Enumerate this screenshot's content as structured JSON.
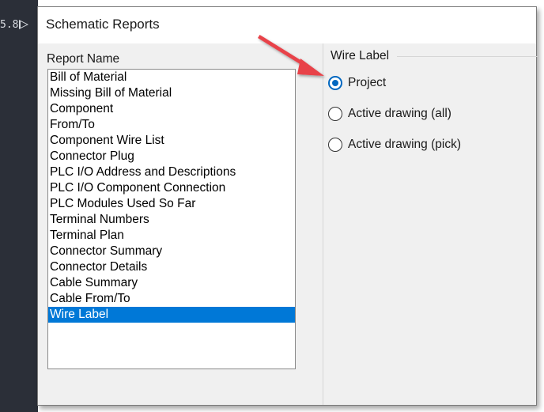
{
  "background": {
    "snippet_text": "5.8"
  },
  "dialog": {
    "title": "Schematic Reports",
    "report_name_label": "Report Name",
    "reports": [
      "Bill of Material",
      "Missing Bill of Material",
      "Component",
      "From/To",
      "Component Wire List",
      "Connector Plug",
      "PLC I/O Address and Descriptions",
      "PLC I/O Component Connection",
      "PLC Modules Used So Far",
      "Terminal Numbers",
      "Terminal Plan",
      "Connector Summary",
      "Connector Details",
      "Cable Summary",
      "Cable From/To",
      "Wire Label"
    ],
    "selected_report": "Wire Label",
    "wire_label_group": {
      "label": "Wire Label",
      "options": [
        {
          "label": "Project",
          "checked": true
        },
        {
          "label": "Active drawing (all)",
          "checked": false
        },
        {
          "label": "Active drawing (pick)",
          "checked": false
        }
      ]
    }
  },
  "colors": {
    "selection": "#0078d7",
    "radio_accent": "#0067c0",
    "annotation_arrow": "#e8424a",
    "cad_background": "#2b2f38"
  },
  "icons": {
    "annotation": "red-arrow-pointer"
  }
}
